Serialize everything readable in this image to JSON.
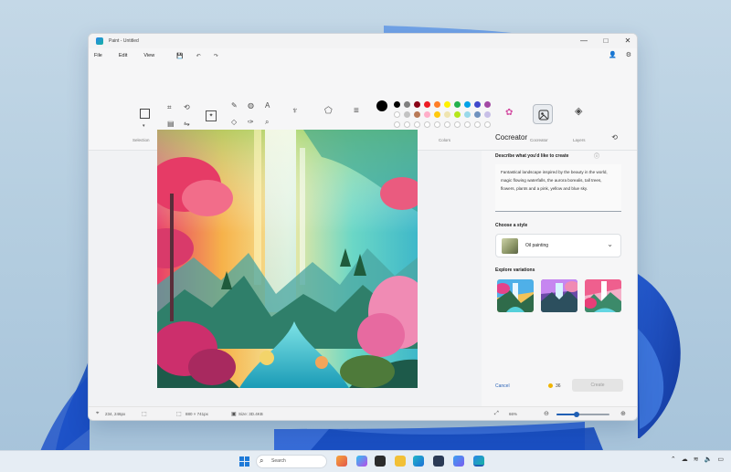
{
  "window": {
    "title": "Paint - Untitled",
    "controls": [
      "—",
      "□",
      "✕"
    ]
  },
  "menu": {
    "items": [
      "File",
      "Edit",
      "View"
    ],
    "quick_access": [
      "💾",
      "↶",
      "↷"
    ],
    "right_icons": [
      "👤",
      "⚙"
    ]
  },
  "ribbon": {
    "groups": [
      "Selection",
      "Image",
      "Tools",
      "Brushes",
      "Shapes",
      "Size",
      "Colors",
      "Cocreator",
      "Layers"
    ]
  },
  "colors": {
    "primary": "#000000",
    "palette_row1": [
      "#000000",
      "#7f7f7f",
      "#880015",
      "#ed1c24",
      "#ff7f27",
      "#fff200",
      "#22b14c",
      "#00a2e8",
      "#3f48cc",
      "#a349a4"
    ],
    "palette_row2": [
      "#ffffff",
      "#c3c3c3",
      "#b97a57",
      "#ffaec9",
      "#ffc90e",
      "#efe4b0",
      "#b5e61d",
      "#99d9ea",
      "#7092be",
      "#c8bfe7"
    ]
  },
  "cocreator": {
    "title": "Cocreator",
    "history_icon": "history-icon",
    "describe_label": "Describe what you'd like to create",
    "prompt": "Fantastical landscape inspired by the beauty in the world, magic flowing waterfalls, the aurora borealis, tall trees, flowers, plants and a pink, yellow and blue sky.",
    "style_label": "Choose a style",
    "style_value": "Oil painting",
    "variations_label": "Explore variations",
    "cancel": "Cancel",
    "credits": "36",
    "create": "Create"
  },
  "status": {
    "position": "234, 246px",
    "dimensions": "880 × 741px",
    "size": "Size: 3D.4KB",
    "zoom": "66%",
    "zoom_level": 0.38
  },
  "taskbar": {
    "search_placeholder": "Search"
  }
}
